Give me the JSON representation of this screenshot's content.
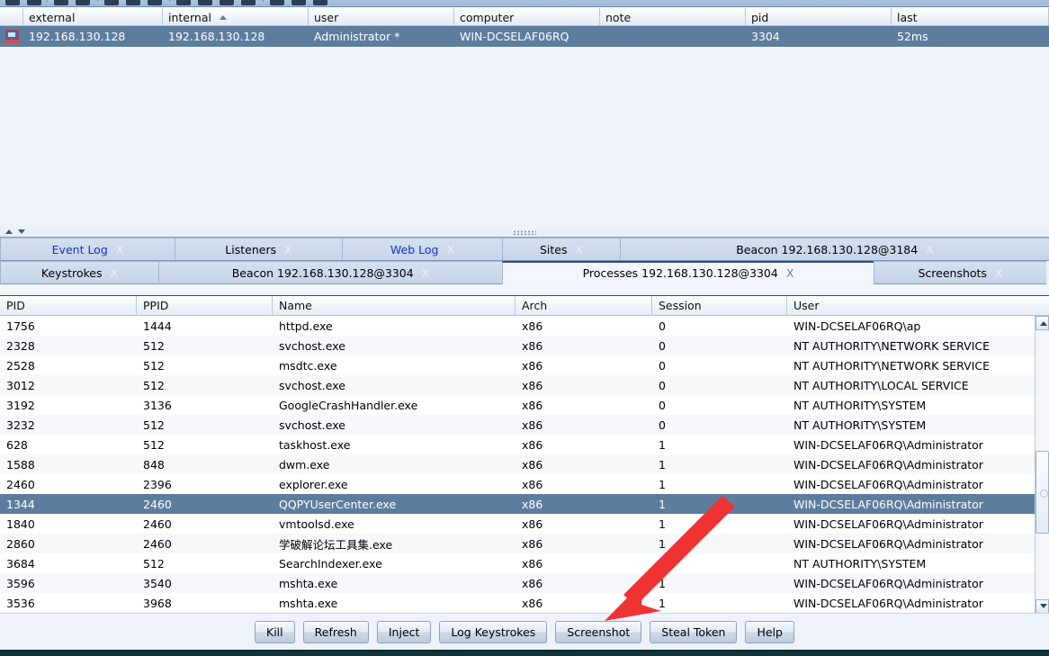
{
  "toolbar": {
    "icon_count": 12
  },
  "sessions": {
    "columns": [
      "external",
      "internal",
      "user",
      "computer",
      "note",
      "pid",
      "last"
    ],
    "sorted_column": "internal",
    "sort_direction": "ascending",
    "rows": [
      {
        "icon": "computer-elevated-icon",
        "external": "192.168.130.128",
        "internal": "192.168.130.128",
        "user": "Administrator *",
        "computer": "WIN-DCSELAF06RQ",
        "note": "",
        "pid": "3304",
        "last": "52ms",
        "selected": true
      }
    ]
  },
  "tabs": {
    "row1": [
      {
        "label": "Event Log",
        "close": "X",
        "style": "blue",
        "active": false
      },
      {
        "label": "Listeners",
        "close": "X",
        "style": "plain",
        "active": false
      },
      {
        "label": "Web Log",
        "close": "X",
        "style": "blue",
        "active": false
      },
      {
        "label": "Sites",
        "close": "X",
        "style": "plain",
        "active": false
      },
      {
        "label": "Beacon 192.168.130.128@3184",
        "close": "X",
        "style": "plain",
        "active": false
      }
    ],
    "row2": [
      {
        "label": "Keystrokes",
        "close": "X",
        "style": "plain",
        "active": false
      },
      {
        "label": "Beacon 192.168.130.128@3304",
        "close": "X",
        "style": "plain",
        "active": false
      },
      {
        "label": "Processes 192.168.130.128@3304",
        "close": "X",
        "style": "plain",
        "active": true
      },
      {
        "label": "Screenshots",
        "close": "X",
        "style": "plain",
        "active": false
      }
    ]
  },
  "processes": {
    "columns": [
      "PID",
      "PPID",
      "Name",
      "Arch",
      "Session",
      "User"
    ],
    "selected_pid": "1344",
    "rows": [
      {
        "pid": "1756",
        "ppid": "1444",
        "name": "httpd.exe",
        "arch": "x86",
        "session": "0",
        "user": "WIN-DCSELAF06RQ\\ap"
      },
      {
        "pid": "2328",
        "ppid": "512",
        "name": "svchost.exe",
        "arch": "x86",
        "session": "0",
        "user": "NT AUTHORITY\\NETWORK SERVICE"
      },
      {
        "pid": "2528",
        "ppid": "512",
        "name": "msdtc.exe",
        "arch": "x86",
        "session": "0",
        "user": "NT AUTHORITY\\NETWORK SERVICE"
      },
      {
        "pid": "3012",
        "ppid": "512",
        "name": "svchost.exe",
        "arch": "x86",
        "session": "0",
        "user": "NT AUTHORITY\\LOCAL SERVICE"
      },
      {
        "pid": "3192",
        "ppid": "3136",
        "name": "GoogleCrashHandler.exe",
        "arch": "x86",
        "session": "0",
        "user": "NT AUTHORITY\\SYSTEM"
      },
      {
        "pid": "3232",
        "ppid": "512",
        "name": "svchost.exe",
        "arch": "x86",
        "session": "0",
        "user": "NT AUTHORITY\\SYSTEM"
      },
      {
        "pid": "628",
        "ppid": "512",
        "name": "taskhost.exe",
        "arch": "x86",
        "session": "1",
        "user": "WIN-DCSELAF06RQ\\Administrator"
      },
      {
        "pid": "1588",
        "ppid": "848",
        "name": "dwm.exe",
        "arch": "x86",
        "session": "1",
        "user": "WIN-DCSELAF06RQ\\Administrator"
      },
      {
        "pid": "2460",
        "ppid": "2396",
        "name": "explorer.exe",
        "arch": "x86",
        "session": "1",
        "user": "WIN-DCSELAF06RQ\\Administrator"
      },
      {
        "pid": "1344",
        "ppid": "2460",
        "name": "QQPYUserCenter.exe",
        "arch": "x86",
        "session": "1",
        "user": "WIN-DCSELAF06RQ\\Administrator"
      },
      {
        "pid": "1840",
        "ppid": "2460",
        "name": "vmtoolsd.exe",
        "arch": "x86",
        "session": "1",
        "user": "WIN-DCSELAF06RQ\\Administrator"
      },
      {
        "pid": "2860",
        "ppid": "2460",
        "name": "学破解论坛工具集.exe",
        "arch": "x86",
        "session": "1",
        "user": "WIN-DCSELAF06RQ\\Administrator"
      },
      {
        "pid": "3684",
        "ppid": "512",
        "name": "SearchIndexer.exe",
        "arch": "x86",
        "session": "1",
        "user": "NT AUTHORITY\\SYSTEM"
      },
      {
        "pid": "3596",
        "ppid": "3540",
        "name": "mshta.exe",
        "arch": "x86",
        "session": "1",
        "user": "WIN-DCSELAF06RQ\\Administrator"
      },
      {
        "pid": "3536",
        "ppid": "3968",
        "name": "mshta.exe",
        "arch": "x86",
        "session": "1",
        "user": "WIN-DCSELAF06RQ\\Administrator"
      }
    ]
  },
  "buttons": [
    {
      "label": "Kill"
    },
    {
      "label": "Refresh"
    },
    {
      "label": "Inject"
    },
    {
      "label": "Log Keystrokes"
    },
    {
      "label": "Screenshot"
    },
    {
      "label": "Steal Token"
    },
    {
      "label": "Help"
    }
  ],
  "annotation": {
    "type": "arrow",
    "color": "#ef3333",
    "points_to": "Screenshot"
  },
  "colors": {
    "selection": "#5d7d9e",
    "tab_blue_text": "#1432d2",
    "annotation_red": "#ef3333",
    "header_gradient_top": "#fdfefe",
    "header_gradient_bottom": "#e3ebf5"
  }
}
